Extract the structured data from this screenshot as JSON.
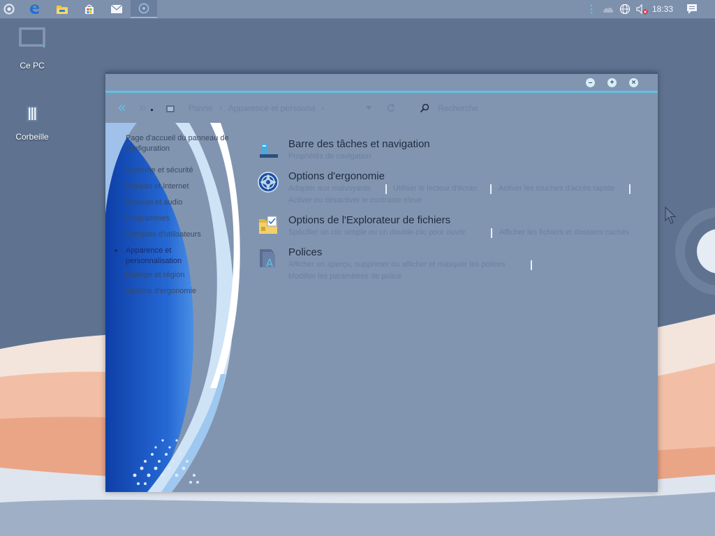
{
  "taskbar": {
    "apps": [
      {
        "name": "cortana-icon"
      },
      {
        "name": "edge-icon"
      },
      {
        "name": "file-explorer-icon"
      },
      {
        "name": "store-icon"
      },
      {
        "name": "mail-icon"
      },
      {
        "name": "control-panel-icon"
      }
    ],
    "tray": {
      "clock": "18:33"
    }
  },
  "desktop": {
    "icons": [
      {
        "label": "Ce PC"
      },
      {
        "label": "Corbeille"
      }
    ]
  },
  "window": {
    "nav": {
      "back": "«",
      "forward": "»",
      "breadcrumb_root": "Panne",
      "breadcrumb_current": "Apparence et personna",
      "search_placeholder": "Recherche"
    },
    "sidebar": {
      "home": "Page d'accueil du panneau de configuration",
      "items": [
        "Système et sécurité",
        "Réseau et Internet",
        "Matériel et audio",
        "Programmes",
        "Comptes d'utilisateurs",
        "Apparence et personnalisation",
        "Horloge et région",
        "Options d'ergonomie"
      ],
      "active_index": 5
    },
    "categories": [
      {
        "title": "Barre des tâches et navigation",
        "links": [
          "Propriétés de navigation"
        ]
      },
      {
        "title": "Options d'ergonomie",
        "links": [
          "Adapter aux malvoyants",
          "Utiliser le lecteur d'écran",
          "Activer les touches d'accès rapide",
          "Activer ou désactiver le contraste élevé"
        ]
      },
      {
        "title": "Options de l'Explorateur de fichiers",
        "links": [
          "Spécifier un clic simple ou un double-clic pour ouvrir",
          "Afficher les fichiers et dossiers cachés"
        ]
      },
      {
        "title": "Polices",
        "links": [
          "Afficher un aperçu, supprimer ou afficher et masquer les polices",
          "Modifier les paramètres de police"
        ]
      }
    ]
  },
  "colors": {
    "accent": "#5fc3e4",
    "window_bg": "#8195b1",
    "taskbar_bg": "#7d90ac"
  }
}
